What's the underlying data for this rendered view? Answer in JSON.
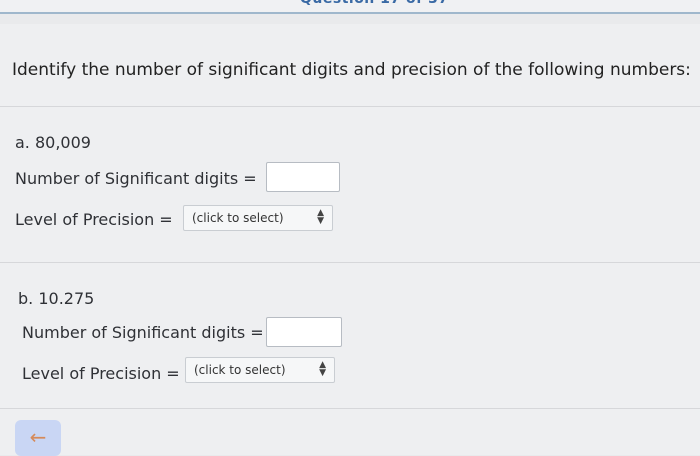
{
  "heading": "Identify the number of significant digits and precision of the following numbers:",
  "questions": [
    {
      "label": "a. 80,009",
      "sig_digits_label": "Number of Significant digits =",
      "sig_digits_value": "",
      "precision_label": "Level of Precision =",
      "precision_value": "(click to select)"
    },
    {
      "label": "b. 10.275",
      "sig_digits_label": "Number of Significant digits =",
      "sig_digits_value": "",
      "precision_label": "Level of Precision =",
      "precision_value": "(click to select)"
    }
  ],
  "navigation": {
    "back_icon": "←"
  },
  "colors": {
    "background": "#eeeff1",
    "accent_bar": "#9fb7cc",
    "back_button": "#c9d6f4"
  }
}
